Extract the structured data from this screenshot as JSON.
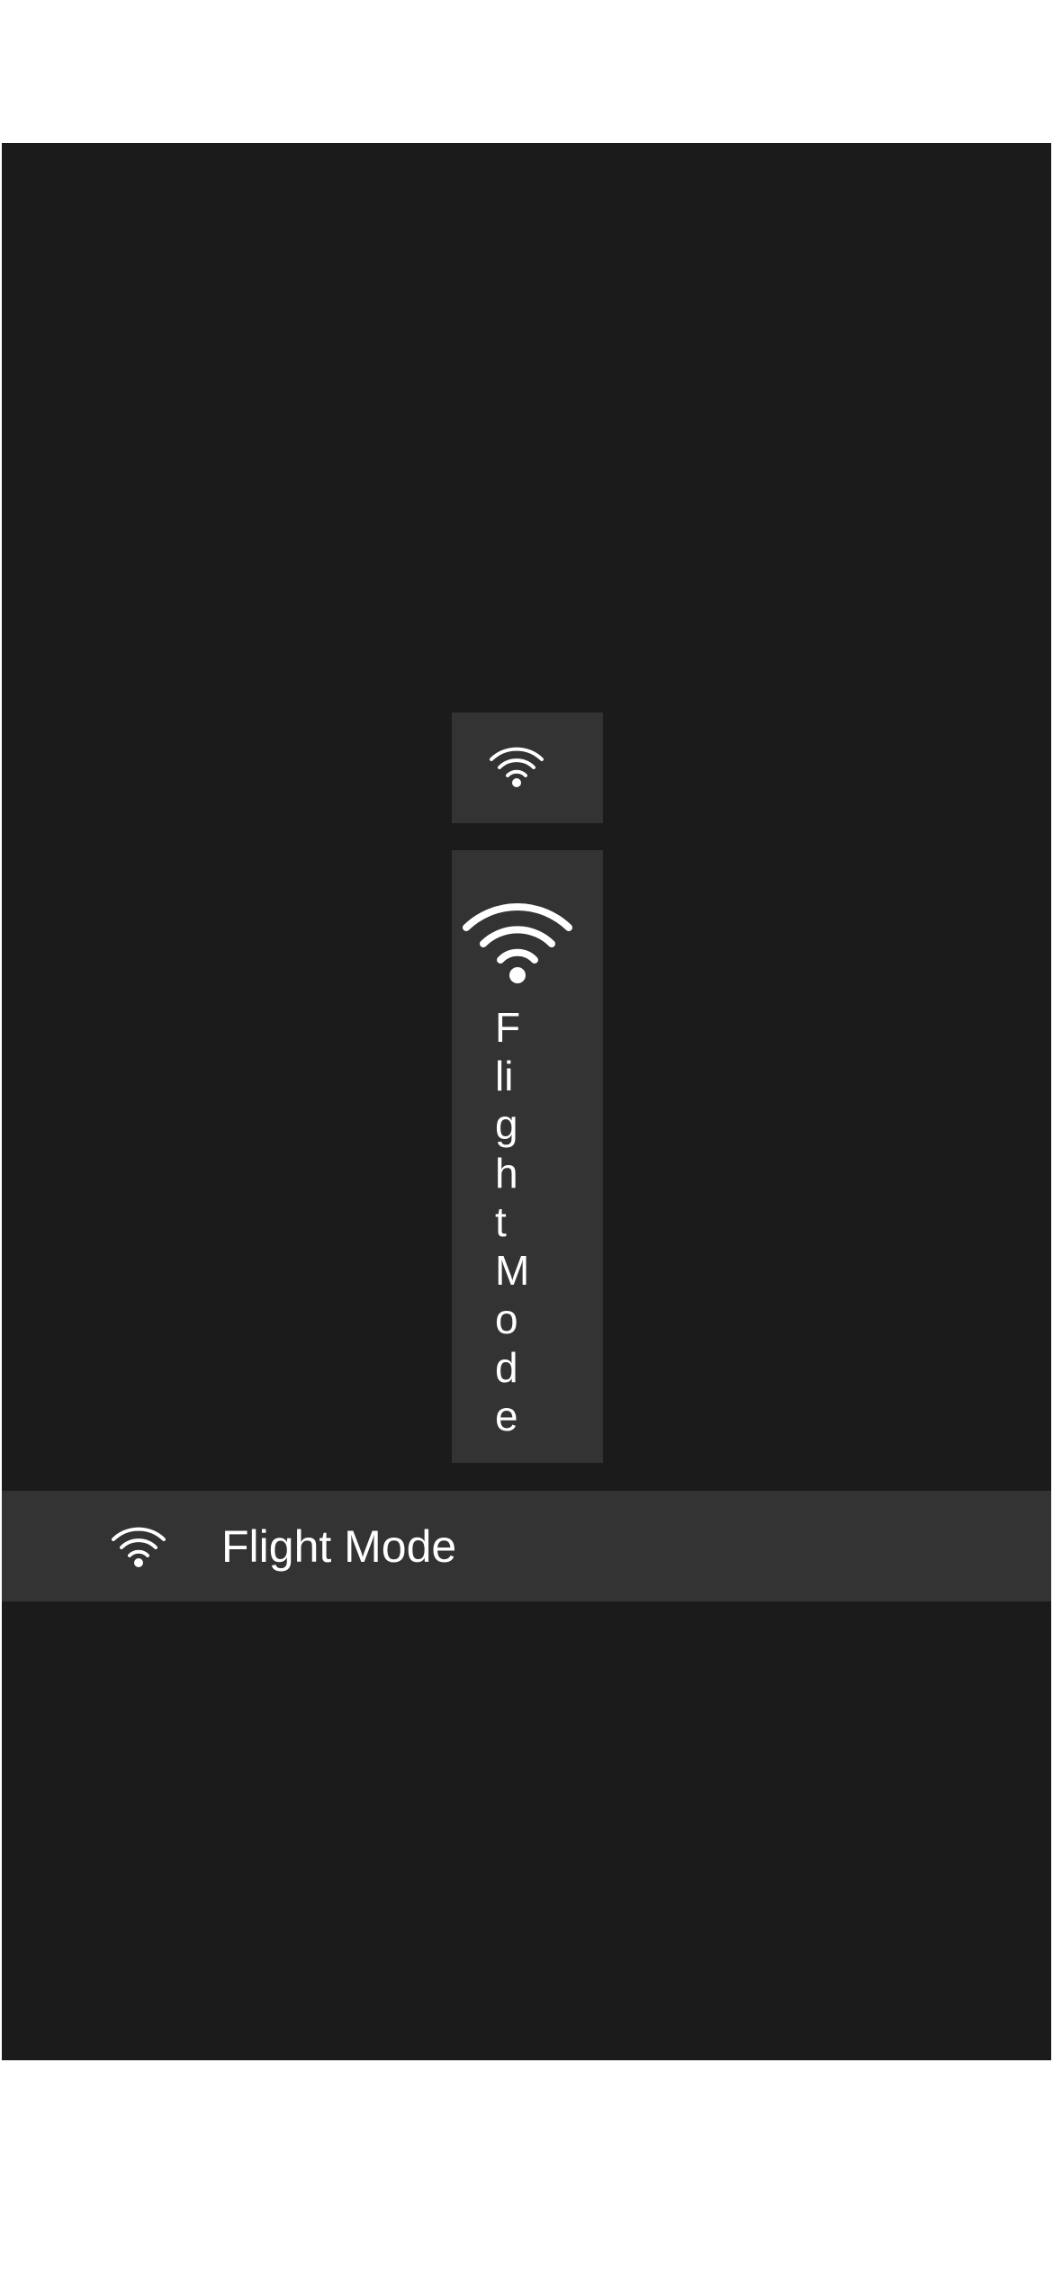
{
  "colors": {
    "page_background": "#ffffff",
    "screen_background": "#1b1b1b",
    "tile_background": "#333333",
    "foreground": "#ffffff"
  },
  "tiles": {
    "small": {
      "icon": "wifi-icon"
    },
    "tall": {
      "icon": "wifi-icon",
      "label": "Flight Mode"
    },
    "wide": {
      "icon": "wifi-icon",
      "label": "Flight Mode"
    }
  }
}
